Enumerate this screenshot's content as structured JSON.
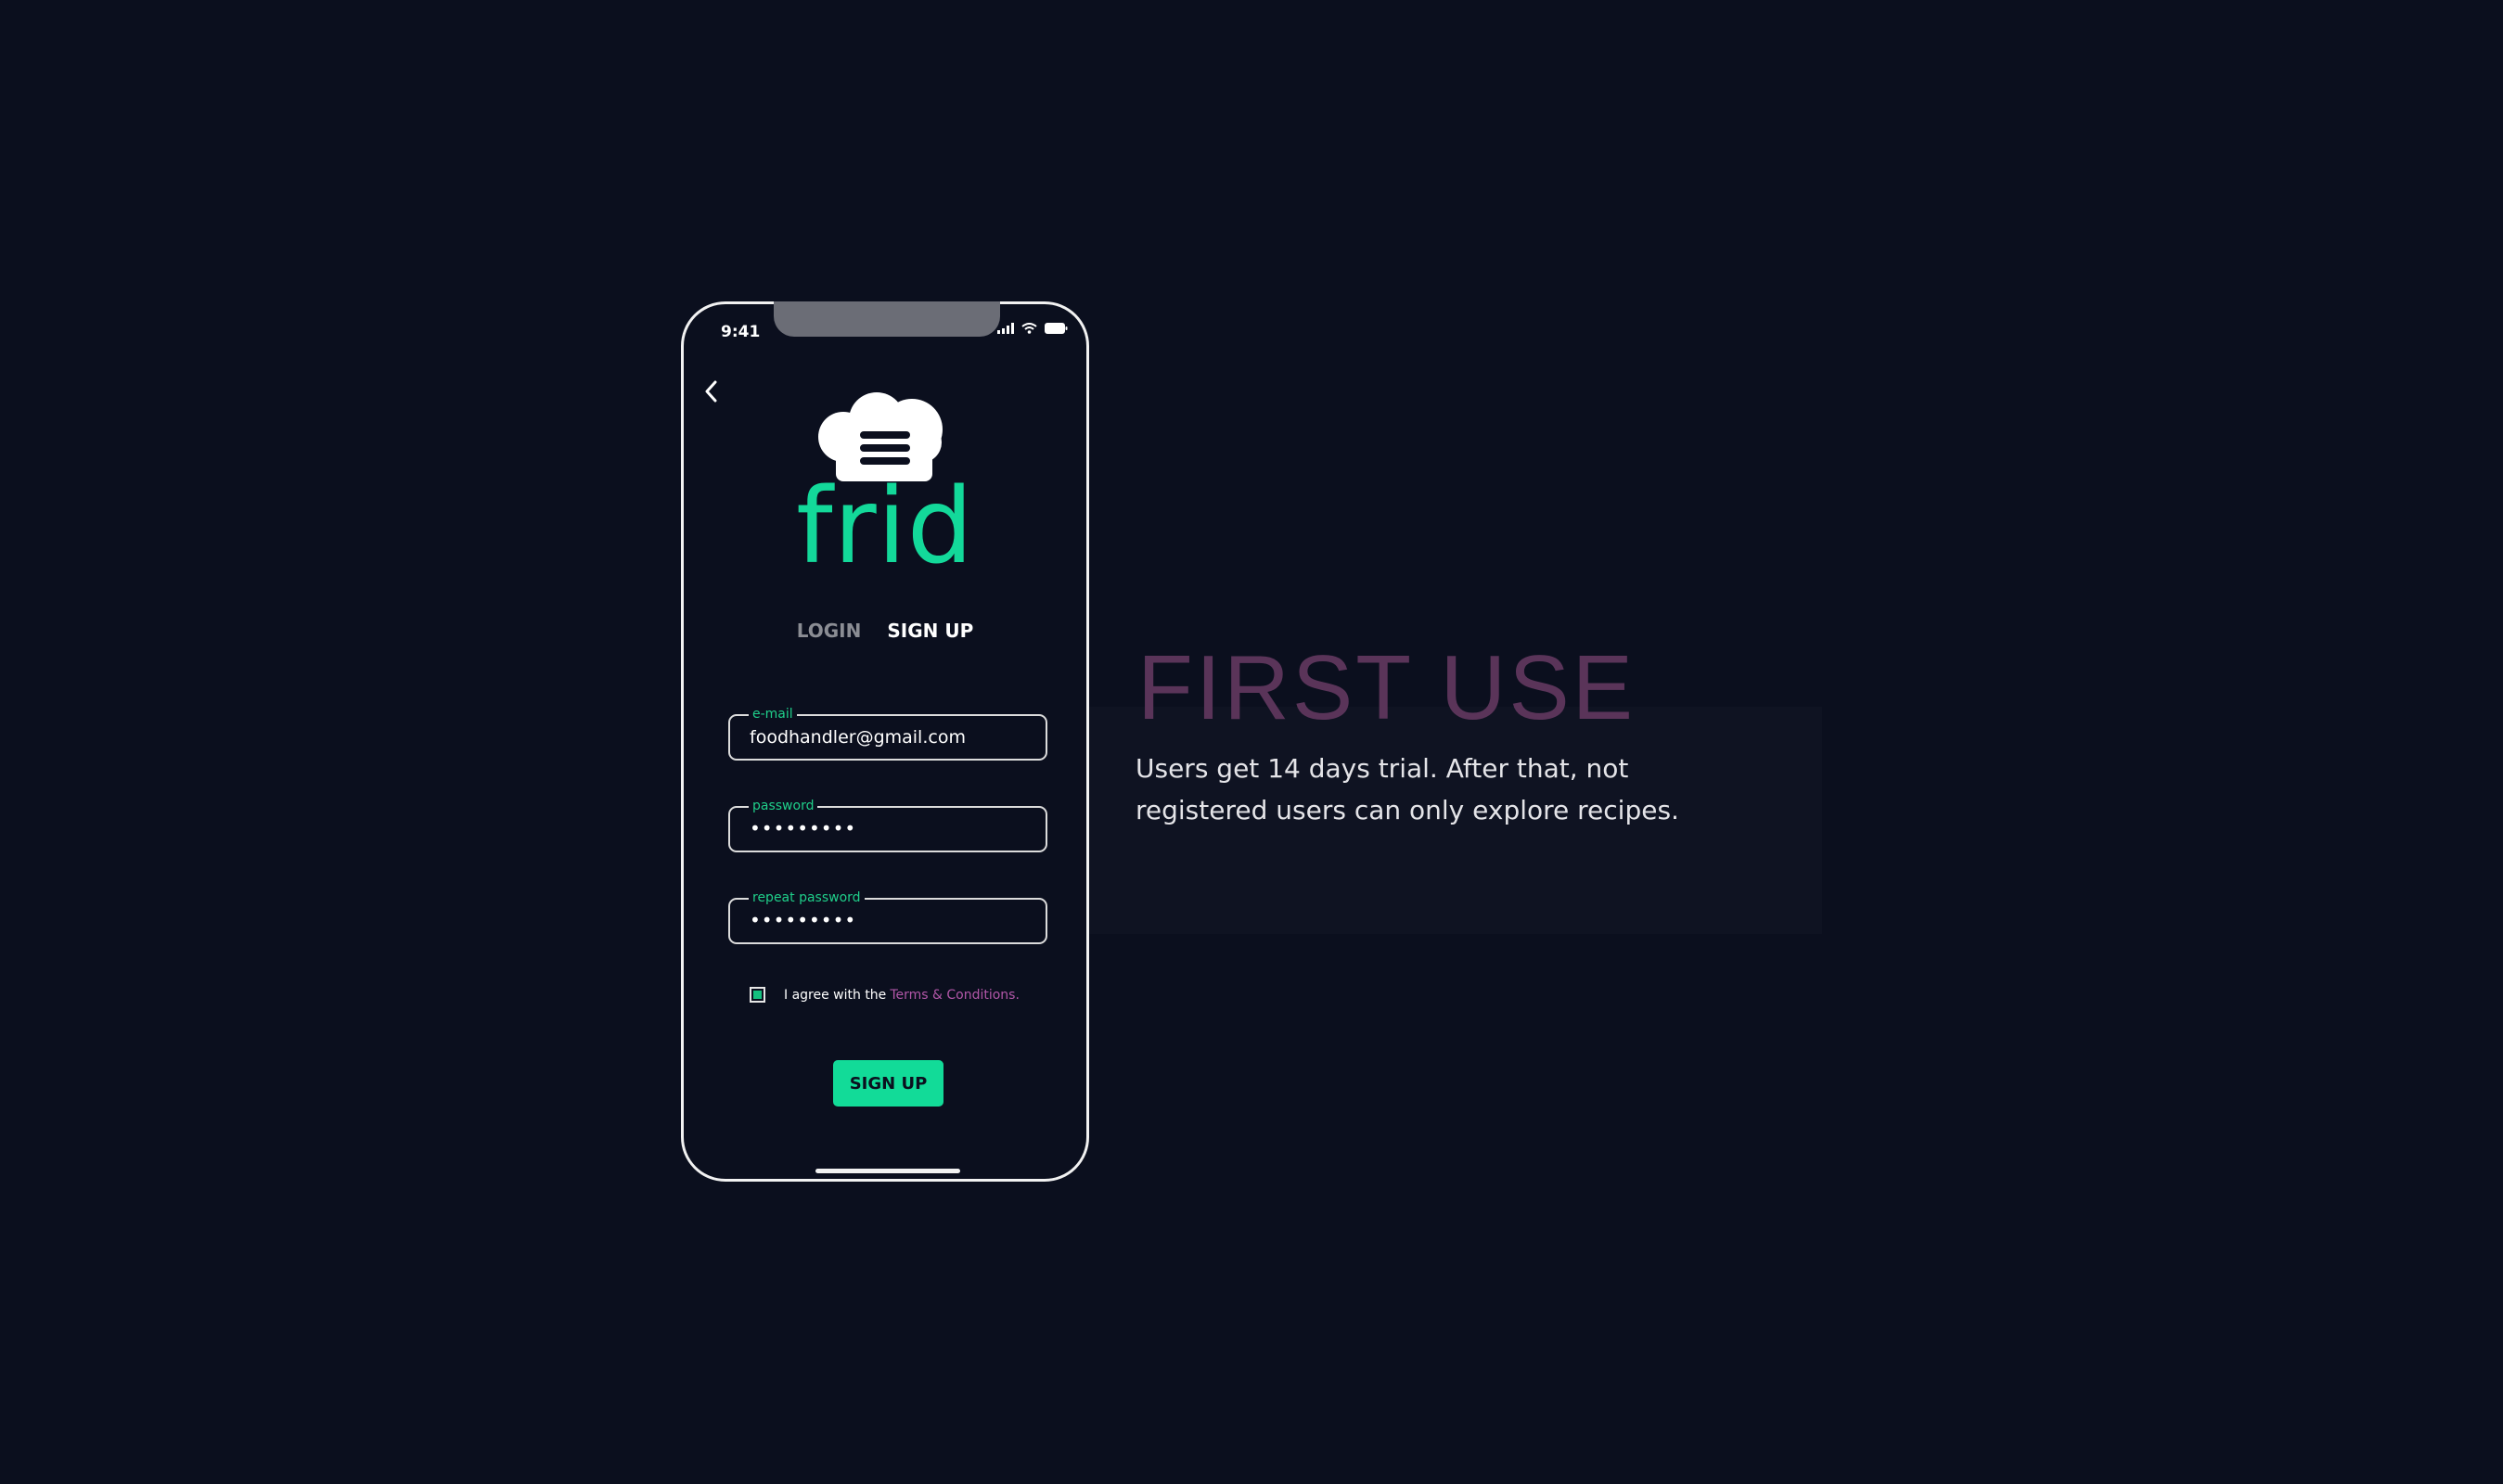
{
  "colors": {
    "background": "#0b0f1e",
    "accent_green": "#12db98",
    "label_green": "#1fcf8a",
    "link_purple": "#b257a8",
    "title_purple": "#5a3459"
  },
  "phone": {
    "status_bar": {
      "time": "9:41",
      "icons": [
        "cellular-signal-icon",
        "wifi-icon",
        "battery-icon"
      ]
    },
    "back_icon": "chevron-left-icon",
    "logo": {
      "icon": "chef-hat-icon",
      "text": "frid"
    },
    "tabs": {
      "login": "LOGIN",
      "signup": "SIGN UP",
      "active": "signup"
    },
    "form": {
      "email": {
        "label": "e-mail",
        "value": "foodhandler@gmail.com"
      },
      "password": {
        "label": "password",
        "value": "•••••••••"
      },
      "repeat_password": {
        "label": "repeat password",
        "value": "•••••••••"
      },
      "agree": {
        "checked": true,
        "text": "I agree with the",
        "link": "Terms & Conditions."
      },
      "submit_label": "SIGN UP"
    }
  },
  "description": {
    "title": "FIRST USE",
    "text": "Users get 14 days trial. After that, not registered users can only explore recipes."
  }
}
